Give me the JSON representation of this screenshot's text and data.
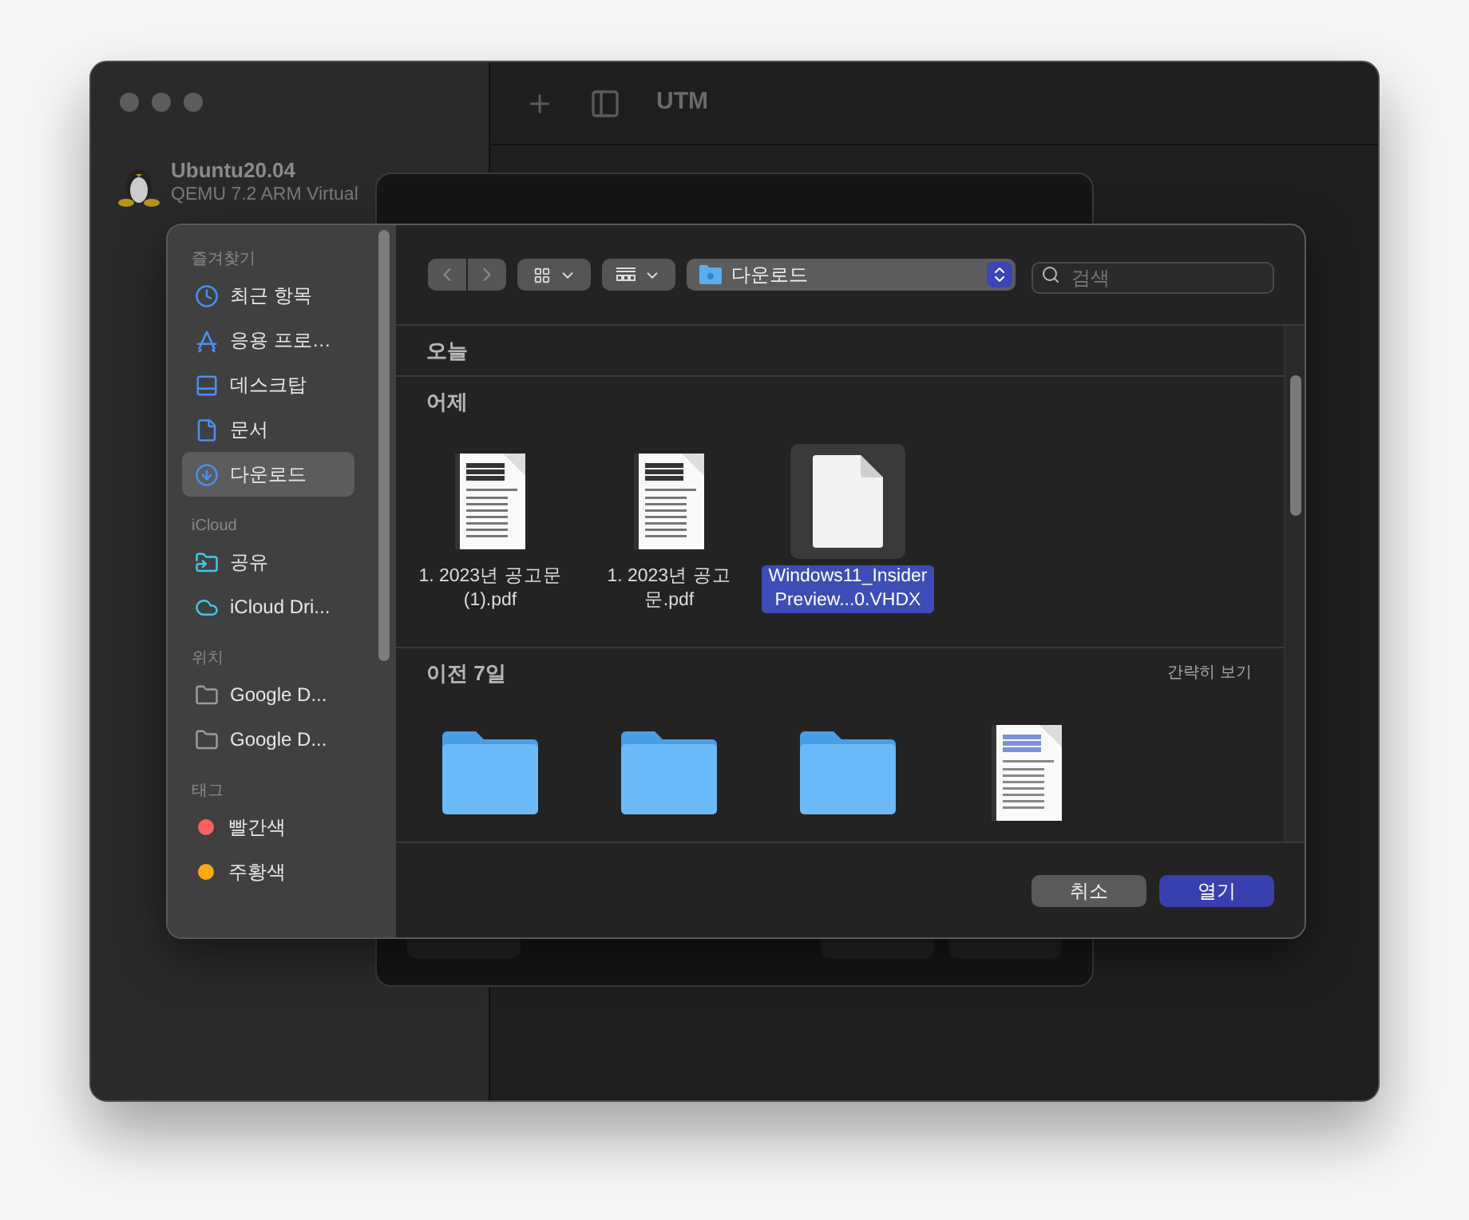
{
  "main_window": {
    "title": "UTM",
    "vm": {
      "name": "Ubuntu20.04",
      "subtitle": "QEMU 7.2 ARM Virtual"
    }
  },
  "dialog": {
    "sidebar": [
      {
        "heading": "즐겨찾기",
        "items": [
          {
            "label": "최근 항목",
            "kind": "clock",
            "selected": false
          },
          {
            "label": "응용 프로…",
            "kind": "apps",
            "selected": false
          },
          {
            "label": "데스크탑",
            "kind": "desktop",
            "selected": false
          },
          {
            "label": "문서",
            "kind": "document",
            "selected": false
          },
          {
            "label": "다운로드",
            "kind": "download",
            "selected": true
          }
        ]
      },
      {
        "heading": "iCloud",
        "items": [
          {
            "label": "공유",
            "kind": "shared",
            "selected": false
          },
          {
            "label": "iCloud Dri...",
            "kind": "cloud",
            "selected": false
          }
        ]
      },
      {
        "heading": "위치",
        "items": [
          {
            "label": "Google D...",
            "kind": "folder",
            "selected": false
          },
          {
            "label": "Google D...",
            "kind": "folder",
            "selected": false
          }
        ]
      },
      {
        "heading": "태그",
        "items": [
          {
            "label": "빨간색",
            "kind": "tag",
            "color": "#ff6060",
            "selected": false
          },
          {
            "label": "주황색",
            "kind": "tag",
            "color": "#ffa90a",
            "selected": false
          }
        ]
      }
    ],
    "path": "다운로드",
    "search": {
      "placeholder": "검색"
    },
    "sections": [
      {
        "title": "오늘"
      },
      {
        "title": "어제",
        "items": [
          {
            "kind": "pdf",
            "name": "1. 2023년 공고문 (1).pdf",
            "selected": false
          },
          {
            "kind": "pdf",
            "name": "1. 2023년 공고 문.pdf",
            "selected": false
          },
          {
            "kind": "file",
            "name": "Windows11_InsiderPreview...0.VHDX",
            "selected": true
          }
        ]
      },
      {
        "title": "이전 7일",
        "action": "간략히 보기",
        "items": [
          {
            "kind": "folder",
            "selected": false
          },
          {
            "kind": "folder",
            "selected": false
          },
          {
            "kind": "folder",
            "selected": false
          },
          {
            "kind": "doc",
            "selected": false
          }
        ]
      }
    ],
    "buttons": [
      {
        "label": "취소",
        "kind": "cancel"
      },
      {
        "label": "열기",
        "kind": "primary"
      }
    ]
  }
}
